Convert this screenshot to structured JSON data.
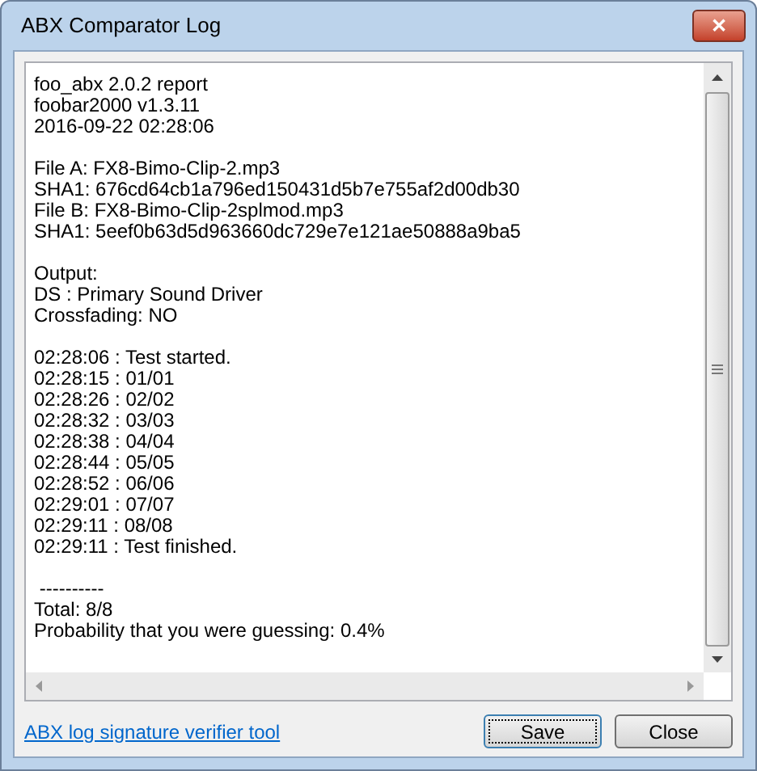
{
  "window": {
    "title": "ABX Comparator Log",
    "close_glyph": "✕"
  },
  "log": {
    "sections": [
      [
        "foo_abx 2.0.2 report",
        "foobar2000 v1.3.11",
        "2016-09-22 02:28:06"
      ],
      [
        "File A: FX8-Bimo-Clip-2.mp3",
        "SHA1: 676cd64cb1a796ed150431d5b7e755af2d00db30",
        "File B: FX8-Bimo-Clip-2splmod.mp3",
        "SHA1: 5eef0b63d5d963660dc729e7e121ae50888a9ba5"
      ],
      [
        "Output:",
        "DS : Primary Sound Driver",
        "Crossfading: NO"
      ],
      [
        "02:28:06 : Test started.",
        "02:28:15 : 01/01",
        "02:28:26 : 02/02",
        "02:28:32 : 03/03",
        "02:28:38 : 04/04",
        "02:28:44 : 05/05",
        "02:28:52 : 06/06",
        "02:29:01 : 07/07",
        "02:29:11 : 08/08",
        "02:29:11 : Test finished."
      ],
      [
        " ----------",
        "Total: 8/8",
        "Probability that you were guessing: 0.4%"
      ]
    ]
  },
  "link": "ABX log signature verifier tool",
  "buttons": [
    {
      "label": "Save",
      "focused": true
    },
    {
      "label": "Close",
      "focused": false
    }
  ]
}
